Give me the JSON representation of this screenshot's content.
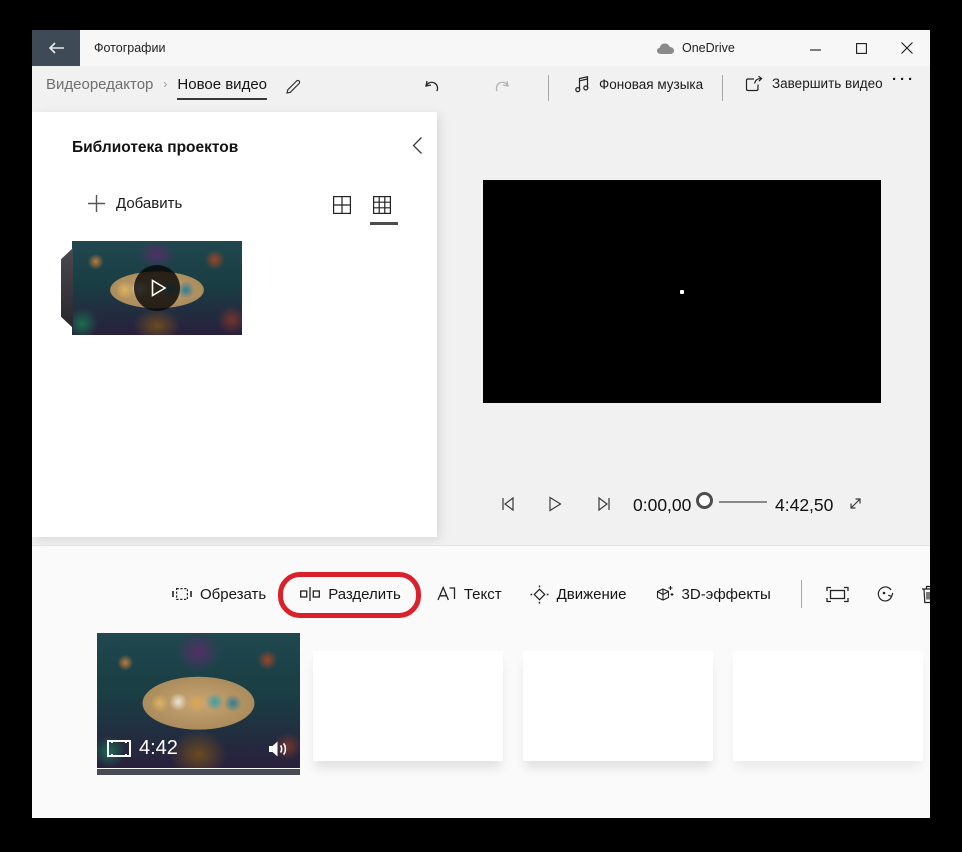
{
  "titlebar": {
    "app_title": "Фотографии",
    "onedrive_label": "OneDrive"
  },
  "breadcrumb": {
    "parent": "Видеоредактор",
    "separator": "›",
    "current": "Новое видео"
  },
  "top_toolbar": {
    "background_music": "Фоновая музыка",
    "finish_video": "Завершить видео",
    "more": "···"
  },
  "library": {
    "title": "Библиотека проектов",
    "add_label": "Добавить"
  },
  "player": {
    "current_time": "0:00,00",
    "total_time": "4:42,50"
  },
  "timeline_toolbar": {
    "trim": "Обрезать",
    "split": "Разделить",
    "text_tool": "Текст",
    "motion": "Движение",
    "effects_3d": "3D-эффекты",
    "more": "···"
  },
  "timeline": {
    "clip_duration": "4:42"
  },
  "colors": {
    "annotation_red": "#d9202b",
    "back_button": "#3e4a55"
  }
}
